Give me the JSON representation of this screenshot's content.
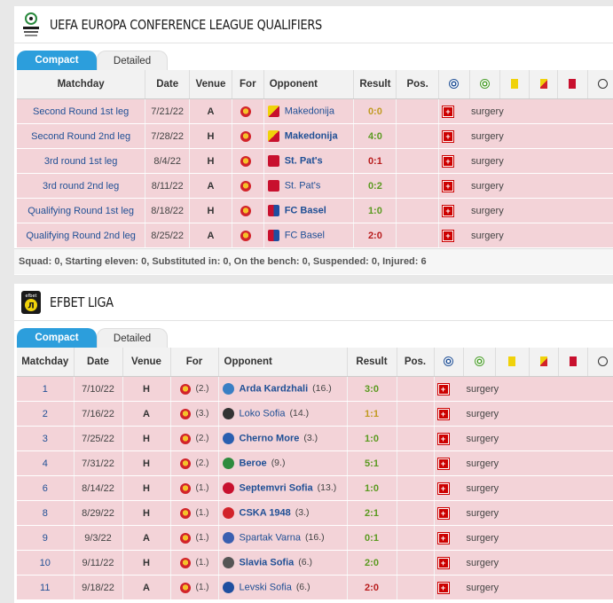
{
  "colors": {
    "accent": "#2c9edc",
    "row_bg": "#f3d3d8",
    "win": "#5a9a20",
    "draw": "#c09a20",
    "loss": "#b81c1c"
  },
  "section1": {
    "title": "UEFA EUROPA CONFERENCE LEAGUE QUALIFIERS",
    "logo_text": "EUROPA CONFERENCE LEAGUE",
    "tabs": {
      "compact": "Compact",
      "detailed": "Detailed"
    },
    "columns": [
      "Matchday",
      "Date",
      "Venue",
      "For",
      "Opponent",
      "Result",
      "Pos."
    ],
    "rows": [
      {
        "matchday": "Second Round 1st leg",
        "date": "7/21/22",
        "venue": "A",
        "opponent": "Makedonija",
        "bold": false,
        "result": "0:0",
        "outcome": "draw",
        "injury": "surgery",
        "opp_icon": "makedonija-crest-icon"
      },
      {
        "matchday": "Second Round 2nd leg",
        "date": "7/28/22",
        "venue": "H",
        "opponent": "Makedonija",
        "bold": true,
        "result": "4:0",
        "outcome": "win",
        "injury": "surgery",
        "opp_icon": "makedonija-crest-icon"
      },
      {
        "matchday": "3rd round 1st leg",
        "date": "8/4/22",
        "venue": "H",
        "opponent": "St. Pat's",
        "bold": true,
        "result": "0:1",
        "outcome": "loss",
        "injury": "surgery",
        "opp_icon": "st-pats-crest-icon"
      },
      {
        "matchday": "3rd round 2nd leg",
        "date": "8/11/22",
        "venue": "A",
        "opponent": "St. Pat's",
        "bold": false,
        "result": "0:2",
        "outcome": "win",
        "injury": "surgery",
        "opp_icon": "st-pats-crest-icon"
      },
      {
        "matchday": "Qualifying Round 1st leg",
        "date": "8/18/22",
        "venue": "H",
        "opponent": "FC Basel",
        "bold": true,
        "result": "1:0",
        "outcome": "win",
        "injury": "surgery",
        "opp_icon": "basel-crest-icon"
      },
      {
        "matchday": "Qualifying Round 2nd leg",
        "date": "8/25/22",
        "venue": "A",
        "opponent": "FC Basel",
        "bold": false,
        "result": "2:0",
        "outcome": "loss",
        "injury": "surgery",
        "opp_icon": "basel-crest-icon"
      }
    ],
    "summary": "Squad: 0, Starting eleven: 0, Substituted in: 0, On the bench: 0, Suspended: 0, Injured: 6"
  },
  "section2": {
    "title": "EFBET LIGA",
    "logo_text": "efbet",
    "tabs": {
      "compact": "Compact",
      "detailed": "Detailed"
    },
    "columns": [
      "Matchday",
      "Date",
      "Venue",
      "For",
      "Opponent",
      "Result",
      "Pos."
    ],
    "rows": [
      {
        "matchday": "1",
        "date": "7/10/22",
        "venue": "H",
        "for_rank": "(2.)",
        "opponent": "Arda Kardzhali",
        "rank": "(16.)",
        "bold": true,
        "result": "3:0",
        "outcome": "win",
        "injury": "surgery",
        "opp_color": "#3a7fc4"
      },
      {
        "matchday": "2",
        "date": "7/16/22",
        "venue": "A",
        "for_rank": "(3.)",
        "opponent": "Loko Sofia",
        "rank": "(14.)",
        "bold": false,
        "result": "1:1",
        "outcome": "draw",
        "injury": "surgery",
        "opp_color": "#333333"
      },
      {
        "matchday": "3",
        "date": "7/25/22",
        "venue": "H",
        "for_rank": "(2.)",
        "opponent": "Cherno More",
        "rank": "(3.)",
        "bold": true,
        "result": "1:0",
        "outcome": "win",
        "injury": "surgery",
        "opp_color": "#2a5fb0"
      },
      {
        "matchday": "4",
        "date": "7/31/22",
        "venue": "H",
        "for_rank": "(2.)",
        "opponent": "Beroe",
        "rank": "(9.)",
        "bold": true,
        "result": "5:1",
        "outcome": "win",
        "injury": "surgery",
        "opp_color": "#2e8b3e"
      },
      {
        "matchday": "6",
        "date": "8/14/22",
        "venue": "H",
        "for_rank": "(1.)",
        "opponent": "Septemvri Sofia",
        "rank": "(13.)",
        "bold": true,
        "result": "1:0",
        "outcome": "win",
        "injury": "surgery",
        "opp_color": "#c8102e"
      },
      {
        "matchday": "8",
        "date": "8/29/22",
        "venue": "H",
        "for_rank": "(1.)",
        "opponent": "CSKA 1948",
        "rank": "(3.)",
        "bold": true,
        "result": "2:1",
        "outcome": "win",
        "injury": "surgery",
        "opp_color": "#d2232a"
      },
      {
        "matchday": "9",
        "date": "9/3/22",
        "venue": "A",
        "for_rank": "(1.)",
        "opponent": "Spartak Varna",
        "rank": "(16.)",
        "bold": false,
        "result": "0:1",
        "outcome": "win",
        "injury": "surgery",
        "opp_color": "#3a5fb0"
      },
      {
        "matchday": "10",
        "date": "9/11/22",
        "venue": "H",
        "for_rank": "(1.)",
        "opponent": "Slavia Sofia",
        "rank": "(6.)",
        "bold": true,
        "result": "2:0",
        "outcome": "win",
        "injury": "surgery",
        "opp_color": "#555555"
      },
      {
        "matchday": "11",
        "date": "9/18/22",
        "venue": "A",
        "for_rank": "(1.)",
        "opponent": "Levski Sofia",
        "rank": "(6.)",
        "bold": false,
        "result": "2:0",
        "outcome": "loss",
        "injury": "surgery",
        "opp_color": "#1f4fa0"
      }
    ]
  }
}
